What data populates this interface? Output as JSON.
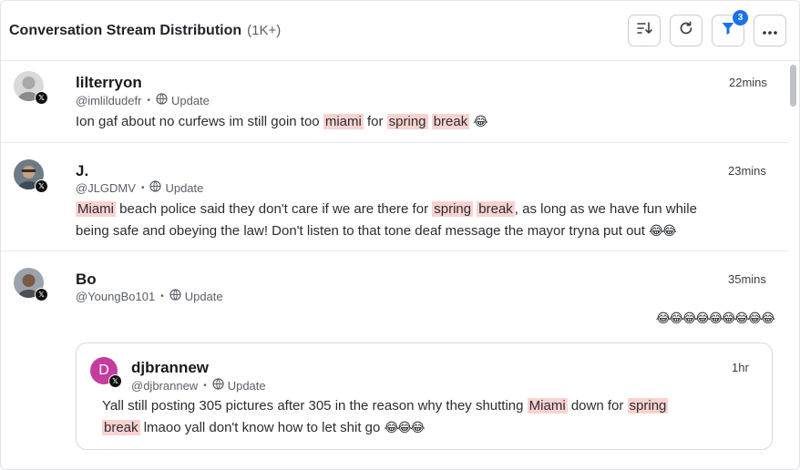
{
  "header": {
    "title": "Conversation Stream Distribution",
    "count": "(1K+)",
    "filter_badge": "3"
  },
  "posts": [
    {
      "name": "lilterryon",
      "handle": "@imlildudefr",
      "source": "Update",
      "time": "22mins",
      "text_before": "Ion gaf about no curfews im still goin too ",
      "hl1": "miami",
      "mid1": " for ",
      "hl2": "spring",
      "hl3": "break",
      "emoji": "😂"
    },
    {
      "name": "J.",
      "handle": "@JLGDMV",
      "source": "Update",
      "time": "23mins",
      "hl1": "Miami",
      "line1_mid": " beach police said they don't care if we are there for ",
      "hl2": "spring",
      "hl3": "break",
      "line1_end": ", as long as we have fun while",
      "line2": "being safe and obeying the law!  Don't listen to that tone deaf message the mayor tryna put out ",
      "emoji": "😂😂"
    },
    {
      "name": "Bo",
      "handle": "@YoungBo101",
      "source": "Update",
      "time": "35mins",
      "emoji": "😂😂😂😂😂😂😂😂😂"
    }
  ],
  "quote": {
    "initial": "D",
    "name": "djbrannew",
    "handle": "@djbrannew",
    "source": "Update",
    "time": "1hr",
    "line1_before": "Yall still posting 305 pictures after 305 in the reason why they shutting ",
    "hl1": "Miami",
    "line1_mid": " down for ",
    "hl2": "spring",
    "hl3": "break",
    "line2_after": " lmaoo yall don't know how to let shit go ",
    "emoji": "😂😂😂"
  }
}
